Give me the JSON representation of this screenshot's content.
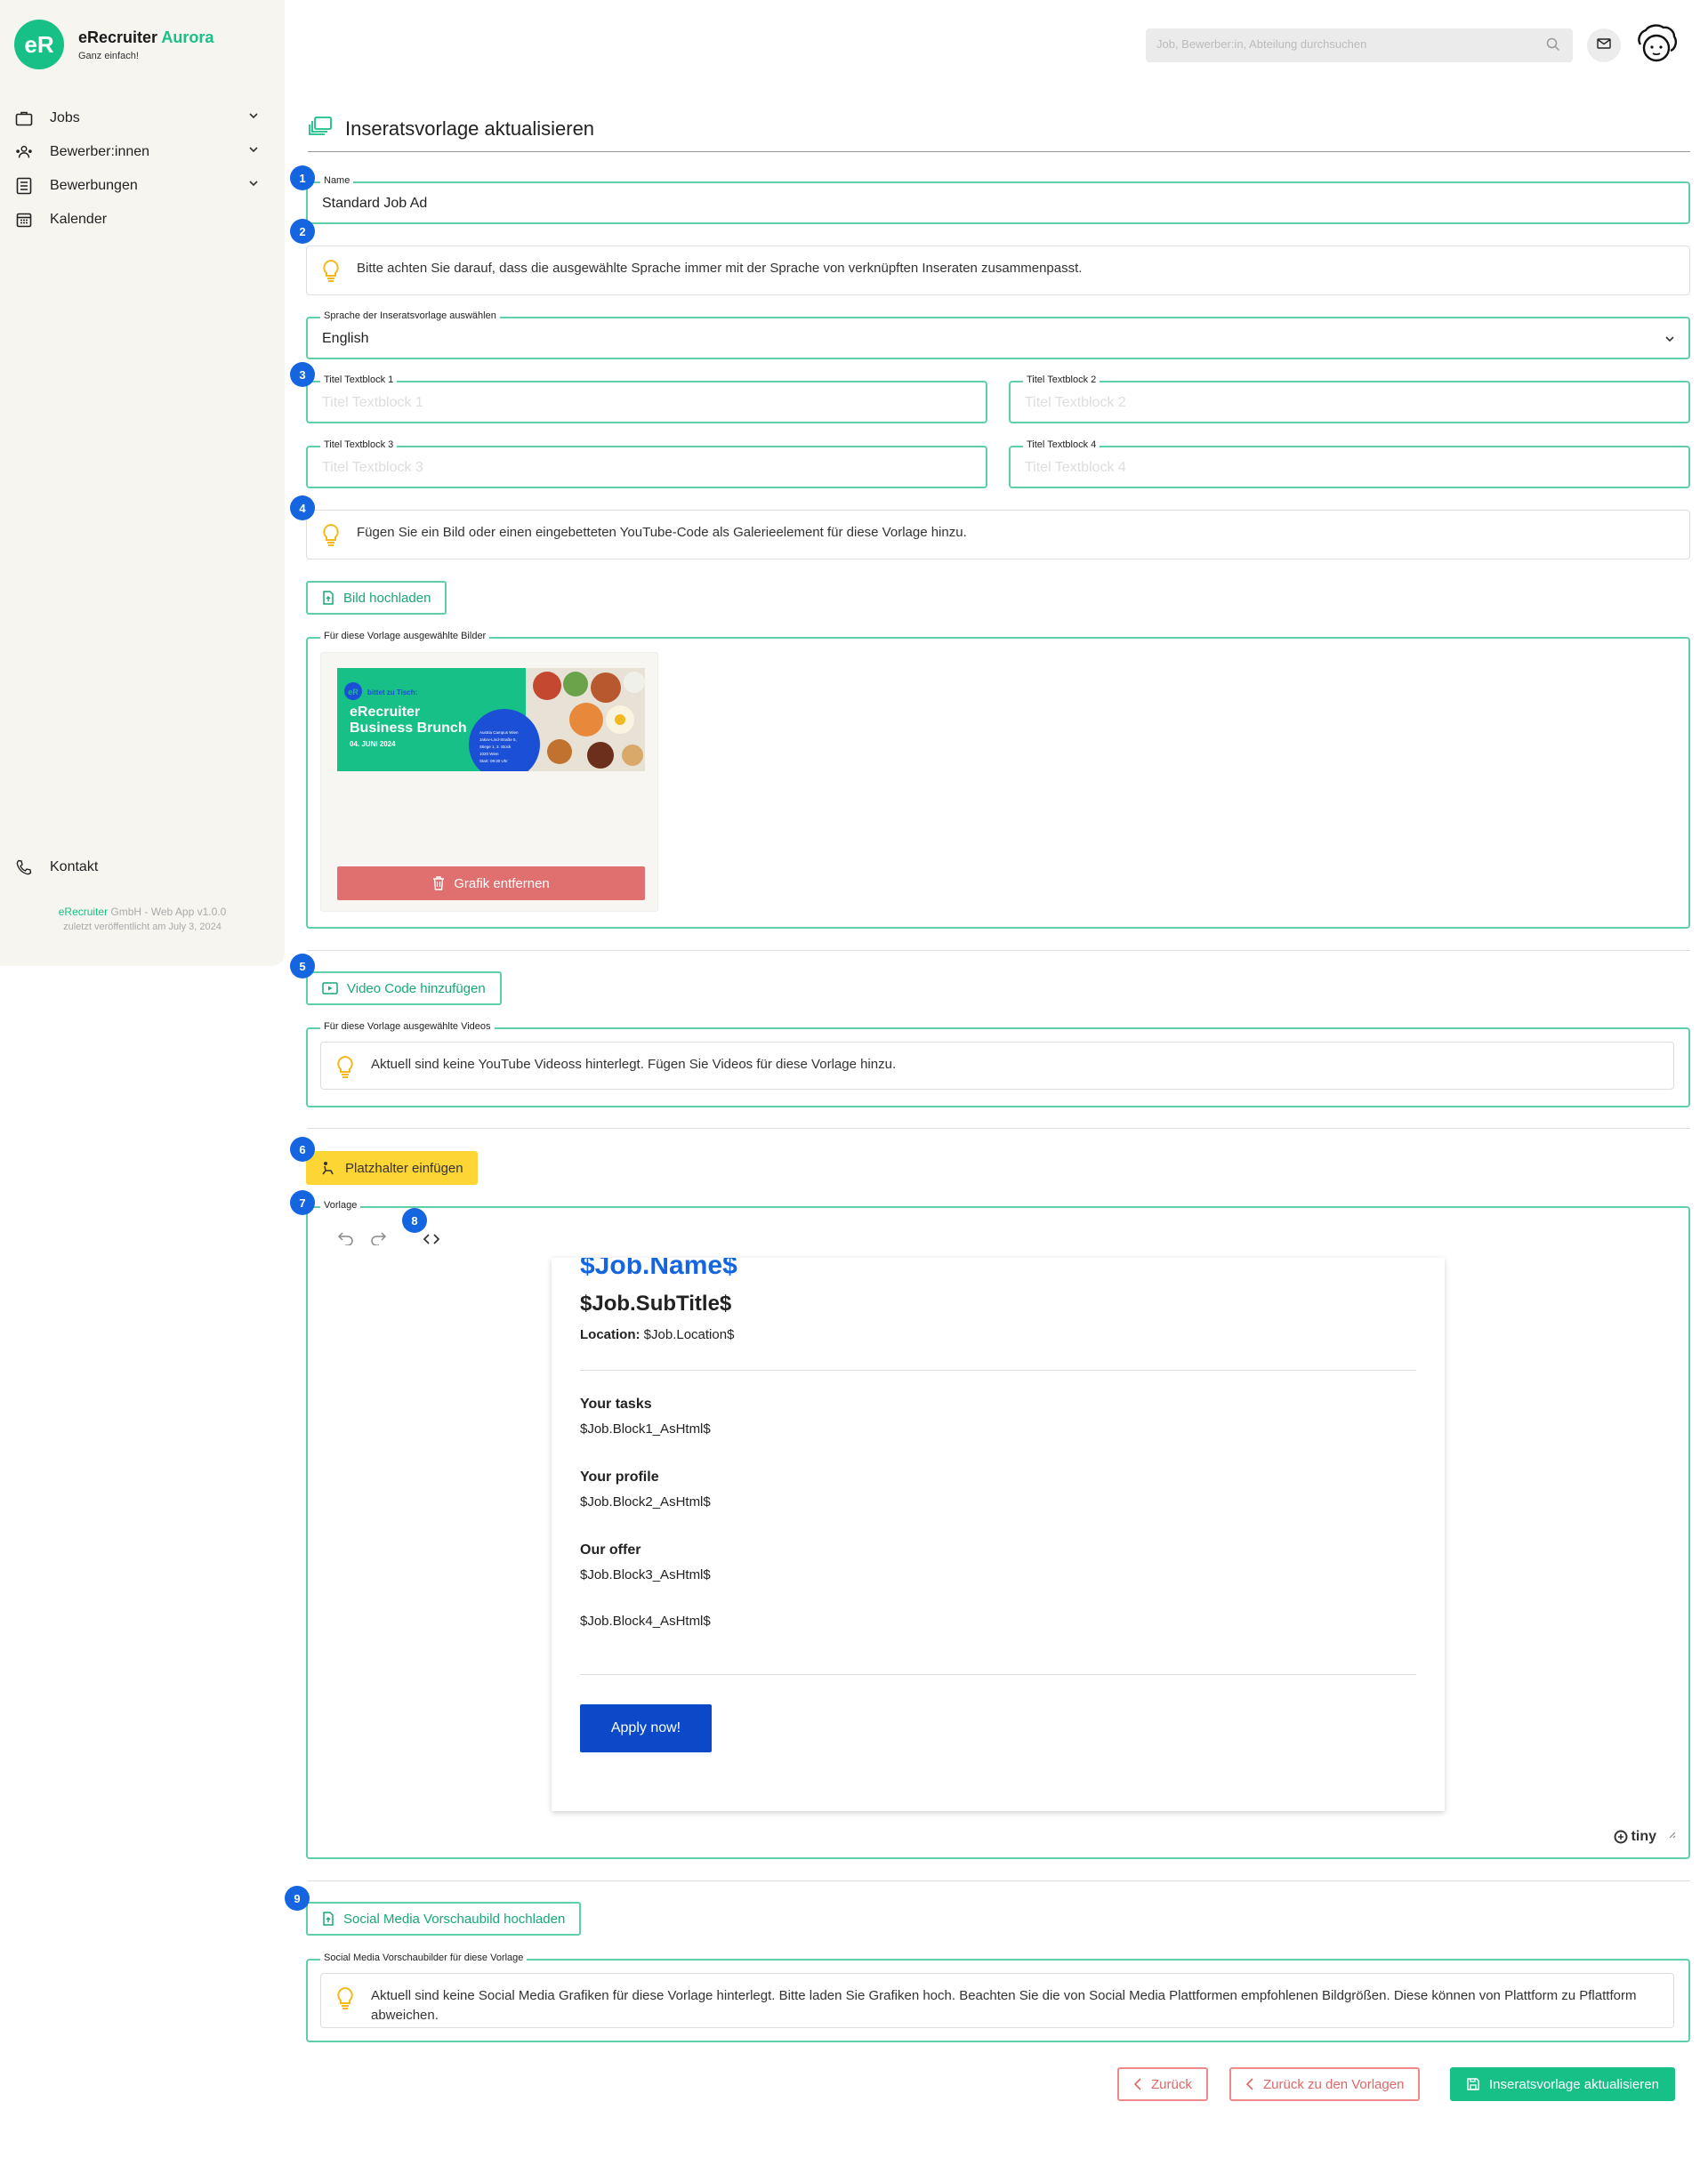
{
  "sidebar": {
    "brand_name": "eRecruiter",
    "brand_accent": "Aurora",
    "brand_tagline": "Ganz einfach!",
    "logo_text": "eR",
    "items": [
      {
        "label": "Jobs",
        "icon": "briefcase-icon",
        "expandable": true
      },
      {
        "label": "Bewerber:innen",
        "icon": "people-icon",
        "expandable": true
      },
      {
        "label": "Bewerbungen",
        "icon": "list-icon",
        "expandable": true
      },
      {
        "label": "Kalender",
        "icon": "calendar-icon",
        "expandable": false
      }
    ],
    "contact_label": "Kontakt",
    "footer_company": "eRecruiter",
    "footer_rest": " GmbH - Web App v1.0.0",
    "footer_published": "zuletzt veröffentlicht am July 3, 2024"
  },
  "topbar": {
    "search_placeholder": "Job, Bewerber:in, Abteilung durchsuchen"
  },
  "page": {
    "title": "Inseratsvorlage aktualisieren"
  },
  "form": {
    "name_label": "Name",
    "name_value": "Standard Job Ad",
    "language_info": "Bitte achten Sie darauf, dass die ausgewählte Sprache immer mit der Sprache von verknüpften Inseraten zusammenpasst.",
    "language_label": "Sprache der Inseratsvorlage auswählen",
    "language_value": "English",
    "block1_label": "Titel Textblock 1",
    "block1_placeholder": "Titel Textblock 1",
    "block2_label": "Titel Textblock 2",
    "block2_placeholder": "Titel Textblock 2",
    "block3_label": "Titel Textblock 3",
    "block3_placeholder": "Titel Textblock 3",
    "block4_label": "Titel Textblock 4",
    "block4_placeholder": "Titel Textblock 4",
    "gallery_info": "Fügen Sie ein Bild oder einen eingebetteten YouTube-Code als Galerieelement für diese Vorlage hinzu.",
    "upload_image_label": "Bild hochladen",
    "images_group_label": "Für diese Vorlage ausgewählte Bilder",
    "banner": {
      "logo": "eR",
      "tagline": "bittet zu Tisch:",
      "title_line1": "eRecruiter",
      "title_line2": "Business Brunch",
      "date": "04. JUNI 2024",
      "details": [
        "Austria Campus Wien",
        "Jakov-Lind-Straße 5,",
        "Stiege 1, 3. Stock",
        "1020 Wien",
        "Start: 09:30 Uhr"
      ]
    },
    "remove_graphic_label": "Grafik entfernen",
    "add_video_label": "Video Code hinzufügen",
    "videos_group_label": "Für diese Vorlage ausgewählte Videos",
    "videos_info": "Aktuell sind keine YouTube Videoss hinterlegt. Fügen Sie Videos für diese Vorlage hinzu.",
    "placeholder_btn_label": "Platzhalter einfügen",
    "template_label": "Vorlage",
    "editor_brand": "tiny",
    "template": {
      "job_name": "$Job.Name$",
      "subtitle": "$Job.SubTitle$",
      "location_label": "Location:",
      "location_value": "$Job.Location$",
      "tasks_heading": "Your tasks",
      "block1": "$Job.Block1_AsHtml$",
      "profile_heading": "Your profile",
      "block2": "$Job.Block2_AsHtml$",
      "offer_heading": "Our offer",
      "block3": "$Job.Block3_AsHtml$",
      "block4": "$Job.Block4_AsHtml$",
      "apply_label": "Apply now!"
    },
    "social_upload_label": "Social Media Vorschaubild hochladen",
    "social_group_label": "Social Media Vorschaubilder für diese Vorlage",
    "social_info": "Aktuell sind keine Social Media Grafiken für diese Vorlage hinterlegt. Bitte laden Sie Grafiken hoch. Beachten Sie die von Social Media Plattformen empfohlenen Bildgrößen. Diese können von Plattform zu Pflattform abweichen."
  },
  "badges": [
    "1",
    "2",
    "3",
    "4",
    "5",
    "6",
    "7",
    "8",
    "9"
  ],
  "actions": {
    "back_label": "Zurück",
    "back_templates_label": "Zurück zu den Vorlagen",
    "submit_label": "Inseratsvorlage aktualisieren"
  },
  "colors": {
    "accent": "#17c086",
    "field_border": "#5ecfa8",
    "badge": "#1565e0",
    "danger": "#e07070",
    "warning": "#fdd535",
    "apply_button": "#0b49c9",
    "job_name_text": "#1565e0"
  }
}
